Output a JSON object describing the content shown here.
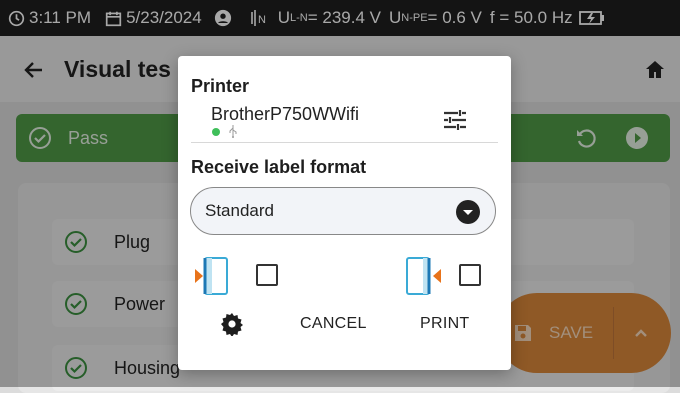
{
  "status_bar": {
    "time": "3:11 PM",
    "date": "5/23/2024",
    "voltage_ln_prefix": "U",
    "voltage_ln_sub": "L-N",
    "voltage_ln_value": " = 239.4 V",
    "voltage_npe_prefix": "U",
    "voltage_npe_sub": "N-PE",
    "voltage_npe_value": " = 0.6 V",
    "frequency": "f = 50.0 Hz",
    "icons": [
      "clock-icon",
      "calendar-icon",
      "account-icon",
      "plug-indicator-icon",
      "battery-charging-icon"
    ]
  },
  "app_bar": {
    "title": "Visual tes",
    "icons": [
      "back-arrow-icon",
      "home-icon"
    ]
  },
  "result_bar": {
    "label": "Pass",
    "color": "#4f9a47",
    "icons": [
      "check-circle-icon",
      "undo-icon",
      "play-icon"
    ]
  },
  "checklist": {
    "items": [
      {
        "label": "Plug"
      },
      {
        "label": "Power"
      },
      {
        "label": "Housing"
      }
    ]
  },
  "save_button": {
    "label": "SAVE",
    "color": "#d9873b",
    "icons": [
      "floppy-icon",
      "chevron-up-icon"
    ]
  },
  "dialog": {
    "printer_heading": "Printer",
    "printer_name": "BrotherP750WWifi",
    "printer_status_color": "#3fbf5a",
    "printer_connection_icon": "usb-icon",
    "printer_settings_icon": "tune-icon",
    "format_heading": "Receive label format",
    "format_value": "Standard",
    "label_options": [
      {
        "icon": "label-left-orientation-icon",
        "checked": false
      },
      {
        "icon": "label-right-orientation-icon",
        "checked": false
      }
    ],
    "cancel_label": "CANCEL",
    "print_label": "PRINT",
    "accent_color": "#e8731a",
    "cyan_color": "#3aaad6"
  }
}
